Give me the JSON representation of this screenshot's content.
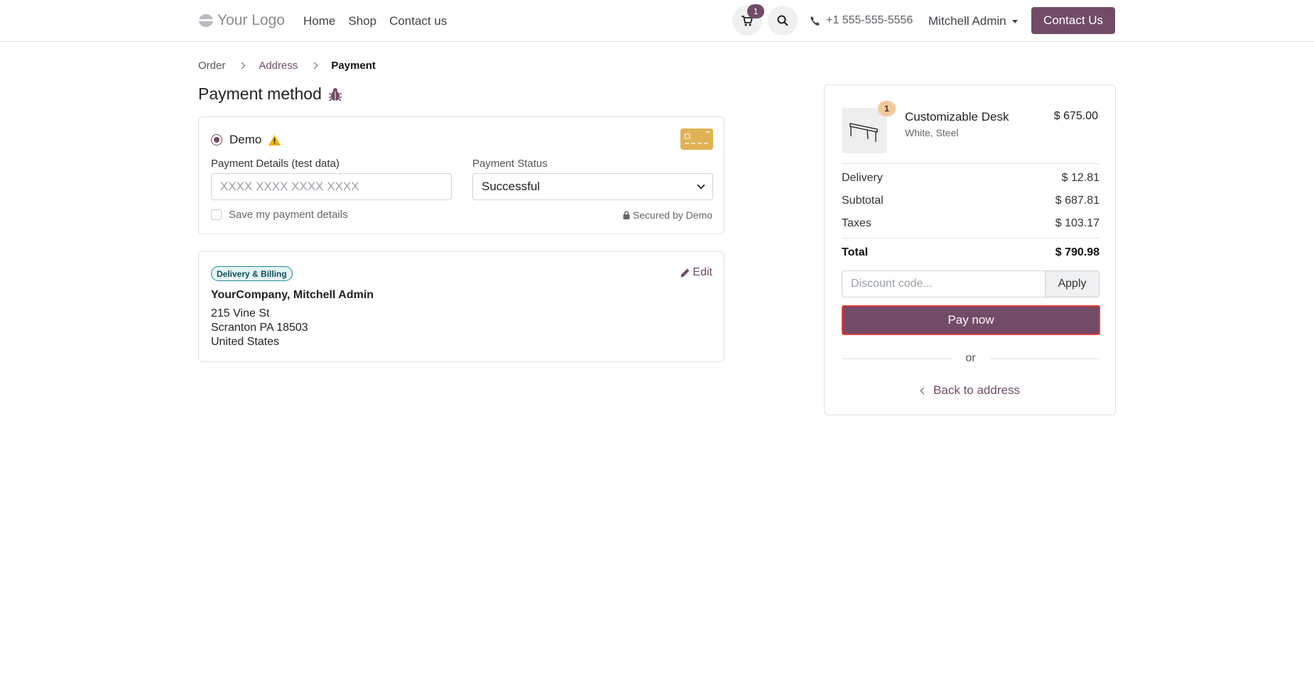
{
  "header": {
    "logo_text": "Your Logo",
    "nav": [
      "Home",
      "Shop",
      "Contact us"
    ],
    "cart_count": "1",
    "phone": "+1 555-555-5556",
    "user": "Mitchell Admin",
    "cta": "Contact Us",
    "accent_color": "#714b67"
  },
  "breadcrumb": {
    "order": "Order",
    "address": "Address",
    "payment": "Payment"
  },
  "page": {
    "title": "Payment method"
  },
  "payment": {
    "method": "Demo",
    "details_label": "Payment Details (test data)",
    "details_placeholder": "XXXX XXXX XXXX XXXX",
    "status_label": "Payment Status",
    "status_value": "Successful",
    "save_label": "Save my payment details",
    "secured_text": "Secured by Demo"
  },
  "address": {
    "badge": "Delivery & Billing",
    "edit": "Edit",
    "name": "YourCompany, Mitchell Admin",
    "lines": [
      "215 Vine St",
      "Scranton PA 18503",
      "United States"
    ]
  },
  "summary": {
    "product_name": "Customizable Desk",
    "product_variant": "White, Steel",
    "product_price": "$ 675.00",
    "product_qty": "1",
    "delivery_label": "Delivery",
    "delivery_value": "$ 12.81",
    "subtotal_label": "Subtotal",
    "subtotal_value": "$ 687.81",
    "taxes_label": "Taxes",
    "taxes_value": "$ 103.17",
    "total_label": "Total",
    "total_value": "$ 790.98",
    "discount_placeholder": "Discount code...",
    "apply": "Apply",
    "pay_now": "Pay now",
    "or": "or",
    "back": "Back to address"
  }
}
